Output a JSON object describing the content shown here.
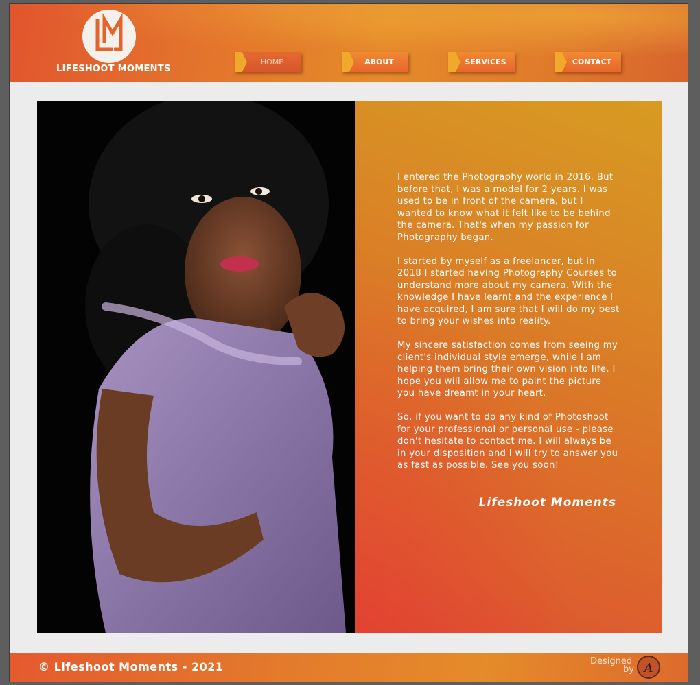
{
  "brand": {
    "logo_letters": "LM",
    "name": "LIFESHOOT MOMENTS"
  },
  "nav": {
    "items": [
      {
        "label": "HOME",
        "active": true
      },
      {
        "label": "ABOUT",
        "active": false
      },
      {
        "label": "SERVICES",
        "active": false
      },
      {
        "label": "CONTACT",
        "active": false
      }
    ]
  },
  "about": {
    "paragraphs": [
      "I entered the Photography world in 2016. But before that, I was a model for 2 years. I was used to be in front of the camera, but I wanted to know what it felt like to be behind the camera. That's when my passion for Photography began.",
      "I started by myself as a freelancer, but in 2018 I started having Photography Courses to understand more about my camera. With the knowledge I have learnt and the experience I have acquired, I am sure that I will do my best to bring your wishes into reality.",
      "My sincere satisfaction comes from seeing my client's individual style emerge, while I am helping them bring their own vision into life. I hope you will allow me to paint the picture you have dreamt in your heart.",
      "So, if you want to do any kind of Photoshoot for your professional or personal use - please don't hesitate to contact me. I will always be in your disposition and I will try to answer you as fast as possible. See you soon!"
    ],
    "signature": "Lifeshoot Moments"
  },
  "footer": {
    "copyright": "© Lifeshoot Moments - 2021",
    "designed_label": "Designed",
    "by_label": "by",
    "designer_mark": "A"
  },
  "colors": {
    "header_orange": "#e3702c",
    "panel_gold": "#d79b22",
    "panel_red": "#de4a32",
    "nav_flag": "#f0a92b"
  }
}
